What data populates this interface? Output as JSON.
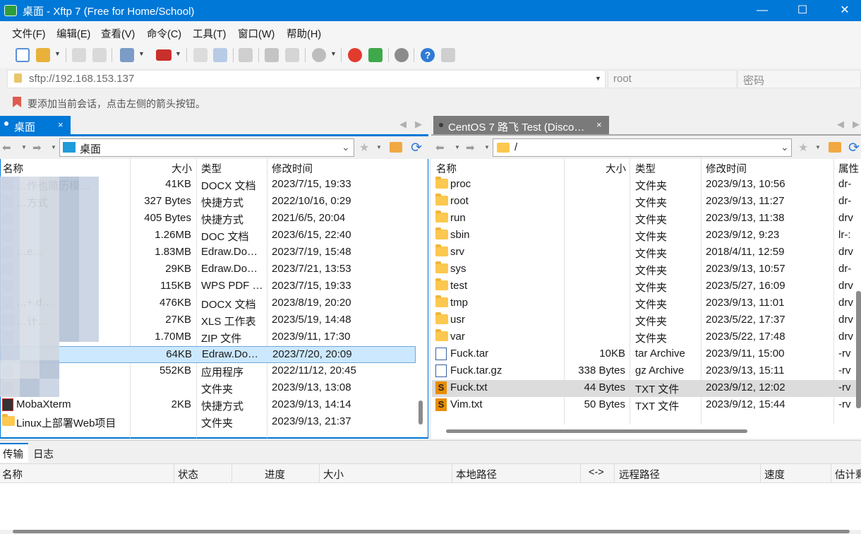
{
  "window": {
    "title": "桌面 - Xftp 7 (Free for Home/School)",
    "minimize": "—",
    "maximize": "☐",
    "close": "✕"
  },
  "menu": [
    "文件(F)",
    "编辑(E)",
    "查看(V)",
    "命令(C)",
    "工具(T)",
    "窗口(W)",
    "帮助(H)"
  ],
  "address": {
    "url": "sftp://192.168.153.137",
    "username_placeholder": "root",
    "password_placeholder": "密码"
  },
  "hint": "要添加当前会话，点击左侧的箭头按钮。",
  "left_pane": {
    "tab": "桌面",
    "path": "桌面",
    "columns": [
      "名称",
      "大小",
      "类型",
      "修改时间"
    ],
    "rows": [
      {
        "name": "…作也简历模…",
        "size": "41KB",
        "type": "DOCX 文档",
        "modified": "2023/7/15, 19:33",
        "icon": "blurred"
      },
      {
        "name": "…方式",
        "size": "327 Bytes",
        "type": "快捷方式",
        "modified": "2022/10/16, 0:29",
        "icon": "blurred"
      },
      {
        "name": "",
        "size": "405 Bytes",
        "type": "快捷方式",
        "modified": "2021/6/5, 20:04",
        "icon": "blurred"
      },
      {
        "name": "",
        "size": "1.26MB",
        "type": "DOC 文档",
        "modified": "2023/6/15, 22:40",
        "icon": "blurred"
      },
      {
        "name": "…e…",
        "size": "1.83MB",
        "type": "Edraw.Do…",
        "modified": "2023/7/19, 15:48",
        "icon": "blurred"
      },
      {
        "name": "",
        "size": "29KB",
        "type": "Edraw.Do…",
        "modified": "2023/7/21, 13:53",
        "icon": "blurred"
      },
      {
        "name": "",
        "size": "115KB",
        "type": "WPS PDF …",
        "modified": "2023/7/15, 19:33",
        "icon": "blurred"
      },
      {
        "name": "…+.d…",
        "size": "476KB",
        "type": "DOCX 文档",
        "modified": "2023/8/19, 20:20",
        "icon": "blurred"
      },
      {
        "name": "…计…",
        "size": "27KB",
        "type": "XLS 工作表",
        "modified": "2023/5/19, 14:48",
        "icon": "blurred"
      },
      {
        "name": "",
        "size": "1.70MB",
        "type": "ZIP 文件",
        "modified": "2023/9/11, 17:30",
        "icon": "blurred"
      },
      {
        "name": "",
        "size": "64KB",
        "type": "Edraw.Do…",
        "modified": "2023/7/20, 20:09",
        "icon": "blurred",
        "selected": true
      },
      {
        "name": "",
        "size": "552KB",
        "type": "应用程序",
        "modified": "2022/11/12, 20:45",
        "icon": "blurred"
      },
      {
        "name": "",
        "size": "",
        "type": "文件夹",
        "modified": "2023/9/13, 13:08",
        "icon": "blurred"
      },
      {
        "name": "MobaXterm",
        "size": "2KB",
        "type": "快捷方式",
        "modified": "2023/9/13, 14:14",
        "icon": "mobaxterm"
      },
      {
        "name": "Linux上部署Web项目",
        "size": "",
        "type": "文件夹",
        "modified": "2023/9/13, 21:37",
        "icon": "folder"
      }
    ]
  },
  "right_pane": {
    "tab": "CentOS 7 路飞 Test (Disco…",
    "path": "/",
    "columns": [
      "名称",
      "大小",
      "类型",
      "修改时间",
      "属性"
    ],
    "rows": [
      {
        "name": "proc",
        "size": "",
        "type": "文件夹",
        "modified": "2023/9/13, 10:56",
        "attr": "dr-",
        "icon": "folder"
      },
      {
        "name": "root",
        "size": "",
        "type": "文件夹",
        "modified": "2023/9/13, 11:27",
        "attr": "dr-",
        "icon": "folder"
      },
      {
        "name": "run",
        "size": "",
        "type": "文件夹",
        "modified": "2023/9/13, 11:38",
        "attr": "drv",
        "icon": "folder"
      },
      {
        "name": "sbin",
        "size": "",
        "type": "文件夹",
        "modified": "2023/9/12, 9:23",
        "attr": "lr-:",
        "icon": "folder-link"
      },
      {
        "name": "srv",
        "size": "",
        "type": "文件夹",
        "modified": "2018/4/11, 12:59",
        "attr": "drv",
        "icon": "folder"
      },
      {
        "name": "sys",
        "size": "",
        "type": "文件夹",
        "modified": "2023/9/13, 10:57",
        "attr": "dr-",
        "icon": "folder"
      },
      {
        "name": "test",
        "size": "",
        "type": "文件夹",
        "modified": "2023/5/27, 16:09",
        "attr": "drv",
        "icon": "folder"
      },
      {
        "name": "tmp",
        "size": "",
        "type": "文件夹",
        "modified": "2023/9/13, 11:01",
        "attr": "drv",
        "icon": "folder"
      },
      {
        "name": "usr",
        "size": "",
        "type": "文件夹",
        "modified": "2023/5/22, 17:37",
        "attr": "drv",
        "icon": "folder"
      },
      {
        "name": "var",
        "size": "",
        "type": "文件夹",
        "modified": "2023/5/22, 17:48",
        "attr": "drv",
        "icon": "folder"
      },
      {
        "name": "Fuck.tar",
        "size": "10KB",
        "type": "tar Archive",
        "modified": "2023/9/11, 15:00",
        "attr": "-rv",
        "icon": "tar"
      },
      {
        "name": "Fuck.tar.gz",
        "size": "338 Bytes",
        "type": "gz Archive",
        "modified": "2023/9/13, 15:11",
        "attr": "-rv",
        "icon": "tar"
      },
      {
        "name": "Fuck.txt",
        "size": "44 Bytes",
        "type": "TXT 文件",
        "modified": "2023/9/12, 12:02",
        "attr": "-rv",
        "icon": "sublime",
        "selected": true
      },
      {
        "name": "Vim.txt",
        "size": "50 Bytes",
        "type": "TXT 文件",
        "modified": "2023/9/12, 15:44",
        "attr": "-rv",
        "icon": "sublime"
      }
    ]
  },
  "transfer": {
    "tabs": [
      "传输",
      "日志"
    ],
    "columns": [
      "名称",
      "状态",
      "进度",
      "大小",
      "本地路径",
      "<->",
      "远程路径",
      "速度",
      "估计剩"
    ]
  },
  "colors": {
    "accent": "#0078d7",
    "selection": "#cce8ff",
    "remote_tab": "#7a7a7a"
  }
}
